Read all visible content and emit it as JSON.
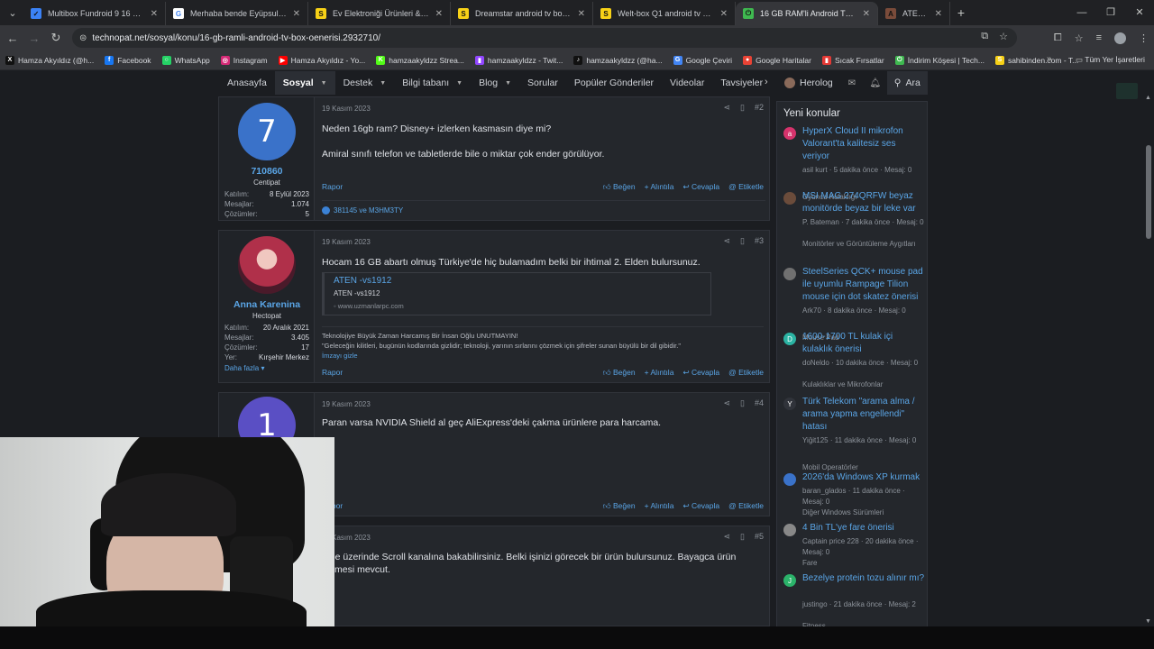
{
  "browser": {
    "tabs": [
      {
        "title": "Multibox Fundroid 9 16 GB 4K Android",
        "icon_color": "#3b82f6",
        "icon_char": "✓"
      },
      {
        "title": "Merhaba bende Eyüpsultan'da",
        "icon_color": "#ffffff",
        "icon_char": "G"
      },
      {
        "title": "Ev Elektroniği Ürünleri & Fiyatları",
        "icon_color": "#f7d117",
        "icon_char": "S"
      },
      {
        "title": "Dreamstar android tv box sahibinden",
        "icon_color": "#f7d117",
        "icon_char": "S"
      },
      {
        "title": "Welt-box Q1 android tv box sahibinden",
        "icon_color": "#f7d117",
        "icon_char": "S"
      },
      {
        "title": "16 GB RAM'li Android TV box önerisi",
        "icon_color": "#3fb950",
        "icon_char": "⏻",
        "active": true
      },
      {
        "title": "ATEN ATEN",
        "icon_color": "#7a4b3a",
        "icon_char": "A",
        "short": true
      }
    ],
    "url": "technopat.net/sosyal/konu/16-gb-ramli-android-tv-box-oenerisi.2932710/",
    "bookmarks": [
      {
        "label": "Hamza Akyıldız (@h...",
        "color": "#111111",
        "char": "X"
      },
      {
        "label": "Facebook",
        "color": "#1877f2",
        "char": "f"
      },
      {
        "label": "WhatsApp",
        "color": "#25d366",
        "char": "○"
      },
      {
        "label": "Instagram",
        "color": "#d62976",
        "char": "◎"
      },
      {
        "label": "Hamza Akyıldız - Yo...",
        "color": "#ff0000",
        "char": "▶"
      },
      {
        "label": "hamzaakyldzz Strea...",
        "color": "#53fc18",
        "char": "K"
      },
      {
        "label": "hamzaakyldzz - Twit...",
        "color": "#9146ff",
        "char": "▮"
      },
      {
        "label": "hamzaakyldzz (@ha...",
        "color": "#111111",
        "char": "♪"
      },
      {
        "label": "Google Çeviri",
        "color": "#4285f4",
        "char": "G"
      },
      {
        "label": "Google Haritalar",
        "color": "#ea4335",
        "char": "●"
      },
      {
        "label": "Sıcak Fırsatlar",
        "color": "#e53935",
        "char": "▮"
      },
      {
        "label": "İndirim Köşesi | Tech...",
        "color": "#3fb950",
        "char": "⏻"
      },
      {
        "label": "sahibinden.com - T...",
        "color": "#f7d117",
        "char": "S"
      }
    ],
    "all_bookmarks": "Tüm Yer İşaretleri"
  },
  "sitenav": {
    "items": [
      {
        "label": "Anasayfa",
        "dropdown": false
      },
      {
        "label": "Sosyal",
        "dropdown": true,
        "active": true
      },
      {
        "label": "Destek",
        "dropdown": true
      },
      {
        "label": "Bilgi tabanı",
        "dropdown": true
      },
      {
        "label": "Blog",
        "dropdown": true
      },
      {
        "label": "Sorular",
        "dropdown": false
      },
      {
        "label": "Popüler Gönderiler",
        "dropdown": false
      },
      {
        "label": "Videolar",
        "dropdown": false
      },
      {
        "label": "Tavsiyeler",
        "dropdown": false
      }
    ],
    "username": "Herolog",
    "search_label": "Ara"
  },
  "posts": [
    {
      "avatar_text": "7",
      "avatar_color": "#3a72c9",
      "username": "710860",
      "user_title": "Centipat",
      "stats": [
        {
          "k": "Katılım:",
          "v": "8 Eylül 2023"
        },
        {
          "k": "Mesajlar:",
          "v": "1.074"
        },
        {
          "k": "Çözümler:",
          "v": "5"
        }
      ],
      "date": "19 Kasım 2023",
      "number": "#2",
      "paragraphs": [
        "Neden 16gb ram? Disney+ izlerken kasmasın diye mi?",
        "Amiral sınıfı telefon ve tabletlerde bile o miktar çok ender görülüyor."
      ],
      "reactions": "381145 ve M3HM3TY"
    },
    {
      "avatar_text": "",
      "avatar_color": "#b0304a",
      "username": "Anna Karenina",
      "user_title": "Hectopat",
      "stats": [
        {
          "k": "Katılım:",
          "v": "20 Aralık 2021"
        },
        {
          "k": "Mesajlar:",
          "v": "3.405"
        },
        {
          "k": "Çözümler:",
          "v": "17"
        },
        {
          "k": "Yer:",
          "v": "Kırşehir Merkez"
        }
      ],
      "more_label": "Daha fazla",
      "date": "19 Kasım 2023",
      "number": "#3",
      "paragraphs": [
        "Hocam 16 GB abartı olmuş Türkiye'de hiç bulamadım belki bir ihtimal 2. Elden bulursunuz."
      ],
      "embed": {
        "title": "ATEN -vs1912",
        "subtitle": "ATEN -vs1912",
        "domain": "www.uzmanlarpc.com"
      },
      "signature": [
        "Teknolojiye Büyük Zaman Harcamış Bir İnsan Oğlu UNUTMAYIN!",
        "\"Geleceğin kilitleri, bugünün kodlarında gizlidir; teknoloji, yarının sırlarını çözmek için şifreler sunan büyülü bir dil gibidir.\""
      ],
      "signature_hide": "İmzayı gizle"
    },
    {
      "avatar_text": "1",
      "avatar_color": "#5a4fc4",
      "date": "19 Kasım 2023",
      "number": "#4",
      "paragraphs": [
        "Paran varsa NVIDIA Shield al geç AliExpress'deki çakma ürünlere para harcama."
      ]
    },
    {
      "date": "19 Kasım 2023",
      "number": "#5",
      "paragraphs": [
        "tube üzerinde Scroll kanalına bakabilirsiniz. Belki işinizi görecek bir ürün bulursunuz. Bayagca ürün elemesi mevcut."
      ]
    }
  ],
  "post_actions": {
    "report": "Rapor",
    "like": "Beğen",
    "quote": "Alıntıla",
    "reply": "Cevapla",
    "tag": "Etiketle"
  },
  "sidebar": {
    "title": "Yeni konular",
    "items": [
      {
        "avatar": "a",
        "color": "#d6336c",
        "title": "HyperX Cloud II mikrofon Valorant'ta kalitesiz ses veriyor",
        "meta": "asil kurt · 5 dakika önce · Mesaj: 0",
        "category": "Oyuncu Kulaklığı"
      },
      {
        "avatar": "",
        "color": "#6b4c3b",
        "title": "MSI MAG 274QRFW beyaz monitörde beyaz bir leke var",
        "meta": "P. Bateman · 7 dakika önce · Mesaj: 0",
        "category": "Monitörler ve Görüntüleme Aygıtları"
      },
      {
        "avatar": "",
        "color": "#707070",
        "title": "SteelSeries QCK+ mouse pad ile uyumlu Rampage Tilion mouse için dot skatez önerisi",
        "meta": "Ark70 · 8 dakika önce · Mesaj: 0",
        "category": "Mouse Pad"
      },
      {
        "avatar": "D",
        "color": "#2bb3a3",
        "title": "1600-1700 TL kulak içi kulaklık önerisi",
        "meta": "doNeldo · 10 dakika önce · Mesaj: 0",
        "category": "Kulaklıklar ve Mikrofonlar"
      },
      {
        "avatar": "Y",
        "color": "#30333a",
        "title": "Türk Telekom \"arama alma / arama yapma engellendi\" hatası",
        "meta": "Yiğit125 · 11 dakika önce · Mesaj: 0",
        "category": "Mobil Operatörler"
      },
      {
        "avatar": "",
        "color": "#3a72c9",
        "title": "2026'da Windows XP kurmak",
        "meta": "baran_glados · 11 dakika önce · Mesaj: 0",
        "category": "Diğer Windows Sürümleri"
      },
      {
        "avatar": "",
        "color": "#888888",
        "title": "4 Bin TL'ye fare önerisi",
        "meta": "Captain price 228 · 20 dakika önce · Mesaj: 0",
        "category": "Fare"
      },
      {
        "avatar": "J",
        "color": "#2bb36a",
        "title": "Bezelye protein tozu alınır mı?",
        "meta": "justingo · 21 dakika önce · Mesaj: 2",
        "category": "Fitness"
      }
    ]
  }
}
